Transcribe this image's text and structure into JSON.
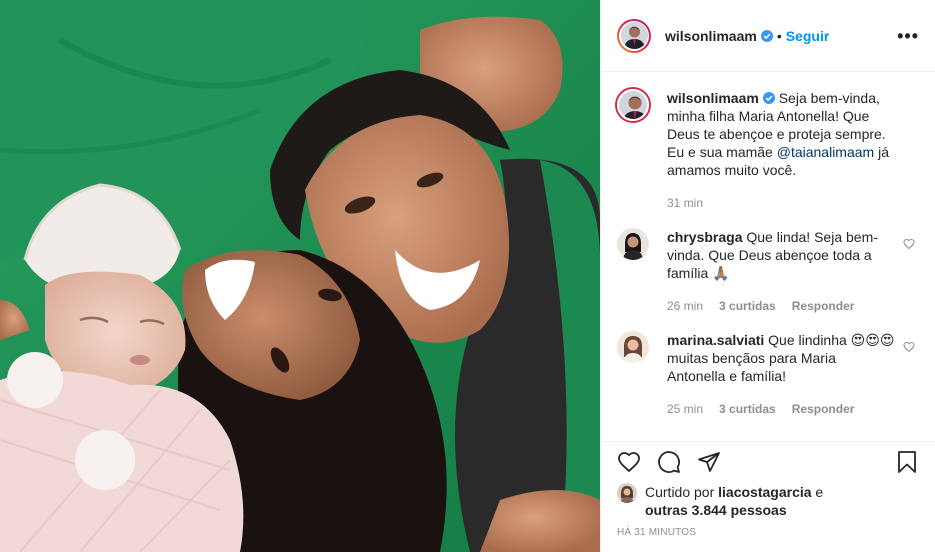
{
  "post": {
    "author": "wilsonlimaam",
    "follow_label": "Seguir",
    "more_label": "•••",
    "separator": "•"
  },
  "caption": {
    "username": "wilsonlimaam",
    "text_before": "Seja bem-vinda, minha filha Maria Antonella! Que Deus te abençoe e proteja sempre. Eu e sua mamãe ",
    "mention": "@taianalimaam",
    "text_after": " já amamos muito você.",
    "time": "31 min"
  },
  "comments": [
    {
      "username": "chrysbraga",
      "text": "Que linda! Seja bem-vinda. Que Deus abençoe toda a família 🙏🏽",
      "time": "26 min",
      "likes": "3 curtidas",
      "reply": "Responder"
    },
    {
      "username": "marina.salviati",
      "text": "Que lindinha 😍😍😍muitas bençãos para Maria Antonella e família!",
      "time": "25 min",
      "likes": "3 curtidas",
      "reply": "Responder"
    }
  ],
  "likes": {
    "prefix": "Curtido por ",
    "first_user": "liacostagarcia",
    "middle": " e ",
    "others": "outras 3.844 pessoas"
  },
  "posted_ago": "HÁ 31 MINUTOS",
  "colors": {
    "accent": "#0095f6",
    "surgical_green": "#1f8a4e",
    "muted": "#8e8e8e"
  },
  "icons": [
    "heart-icon",
    "comment-icon",
    "share-icon",
    "bookmark-icon",
    "verified-icon",
    "more-icon"
  ]
}
